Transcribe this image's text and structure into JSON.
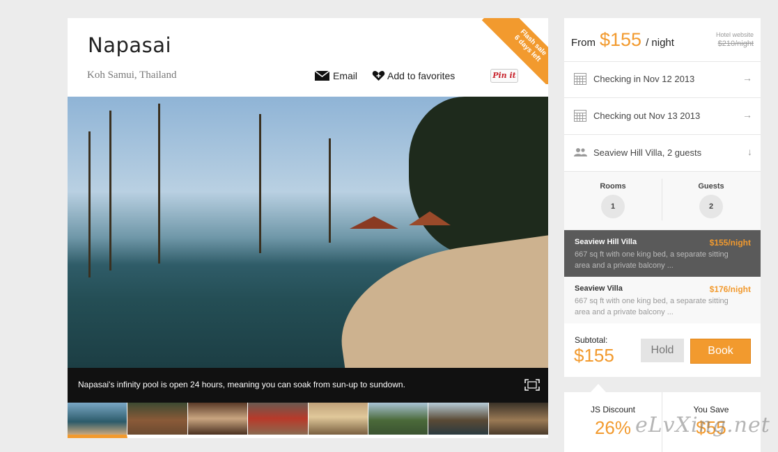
{
  "hotel": {
    "name": "Napasai",
    "location": "Koh Samui, Thailand",
    "email_label": "Email",
    "favorites_label": "Add to favorites",
    "pin_label": "Pin it",
    "ribbon_line1": "Flash sale",
    "ribbon_line2": "6 days left"
  },
  "gallery": {
    "caption": "Napasai's infinity pool is open 24 hours, meaning you can soak from sun-up to sundown.",
    "thumb_count": 8,
    "active_thumb": 1
  },
  "booking": {
    "from_label": "From",
    "price": "$155",
    "per_night": "/ night",
    "hotel_website_label": "Hotel website",
    "hotel_website_price": "$210/night",
    "check_in": "Checking in Nov 12 2013",
    "check_out": "Checking out Nov 13 2013",
    "room_guests": "Seaview Hill Villa, 2 guests",
    "rooms_label": "Rooms",
    "rooms_value": "1",
    "guests_label": "Guests",
    "guests_value": "2",
    "rooms": [
      {
        "name": "Seaview Hill Villa",
        "price": "$155/night",
        "desc": "667 sq ft with one king bed, a separate sitting area and a private balcony ..."
      },
      {
        "name": "Seaview Villa",
        "price": "$176/night",
        "desc": "667 sq ft with one king bed, a separate sitting area and a private balcony ..."
      }
    ],
    "subtotal_label": "Subtotal:",
    "subtotal_value": "$155",
    "hold_label": "Hold",
    "book_label": "Book"
  },
  "discount": {
    "discount_label": "JS Discount",
    "discount_value": "26%",
    "save_label": "You Save",
    "save_value": "$55"
  },
  "watermark": "eLvXing.net",
  "colors": {
    "accent": "#f29a2e",
    "dark": "#5a5a5a",
    "background": "#ececec"
  }
}
